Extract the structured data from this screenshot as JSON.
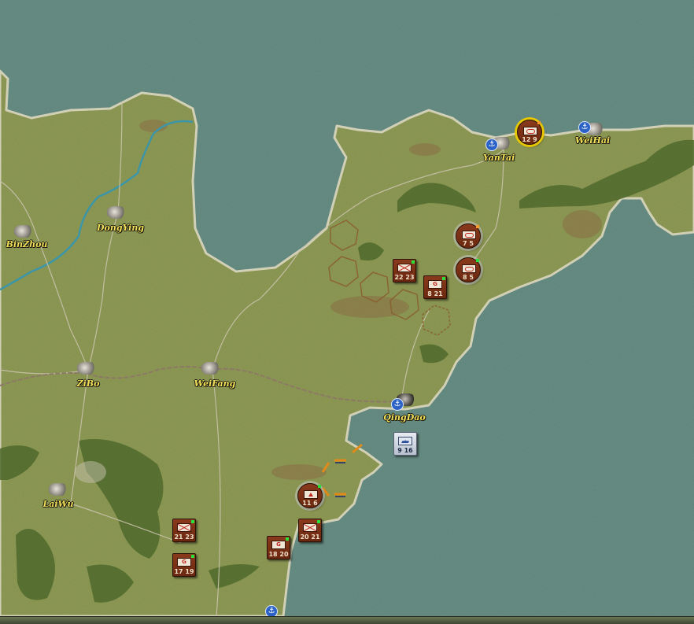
{
  "map": {
    "colors": {
      "sea": "#5b8a93",
      "land": "#8e9a55",
      "forest": "#4f6a2c",
      "road": "#c9c2ab",
      "river": "#3d95a8",
      "rail": "#8d7a66"
    }
  },
  "cities": [
    {
      "name": "BinZhou",
      "has_port": false
    },
    {
      "name": "DongYing",
      "has_port": false
    },
    {
      "name": "ZiBo",
      "has_port": false
    },
    {
      "name": "WeiFang",
      "has_port": false
    },
    {
      "name": "LaiWu",
      "has_port": false
    },
    {
      "name": "YanTai",
      "has_port": true
    },
    {
      "name": "WeiHai",
      "has_port": true
    },
    {
      "name": "QingDao",
      "has_port": true
    }
  ],
  "units": [
    {
      "id": "u1",
      "symbol": "armor",
      "strength": "12 9",
      "selected": true,
      "ringed": true,
      "indicator": "orange"
    },
    {
      "id": "u2",
      "symbol": "armor",
      "strength": "7 5",
      "ringed": true,
      "indicator": "orange"
    },
    {
      "id": "u3",
      "symbol": "armor",
      "strength": "8 5",
      "ringed": true,
      "indicator": "green"
    },
    {
      "id": "u4",
      "symbol": "infantry",
      "strength": "22 23",
      "indicator": "green"
    },
    {
      "id": "u5",
      "symbol": "mech",
      "symbol_text": "G",
      "strength": "8 21",
      "indicator": "green"
    },
    {
      "id": "u6",
      "symbol": "mountain",
      "strength": "11 6",
      "ringed": true,
      "indicator": "green"
    },
    {
      "id": "u7",
      "symbol": "infantry",
      "strength": "20 21",
      "indicator": "green"
    },
    {
      "id": "u8",
      "symbol": "mech",
      "symbol_text": "G",
      "strength": "18 20",
      "indicator": "green"
    },
    {
      "id": "u9",
      "symbol": "infantry",
      "strength": "21 23",
      "indicator": "green"
    },
    {
      "id": "u10",
      "symbol": "mech",
      "symbol_text": "G",
      "strength": "17 19",
      "indicator": "green"
    }
  ],
  "naval_units": [
    {
      "id": "n1",
      "symbol": "fleet",
      "strength": "9 16"
    }
  ]
}
